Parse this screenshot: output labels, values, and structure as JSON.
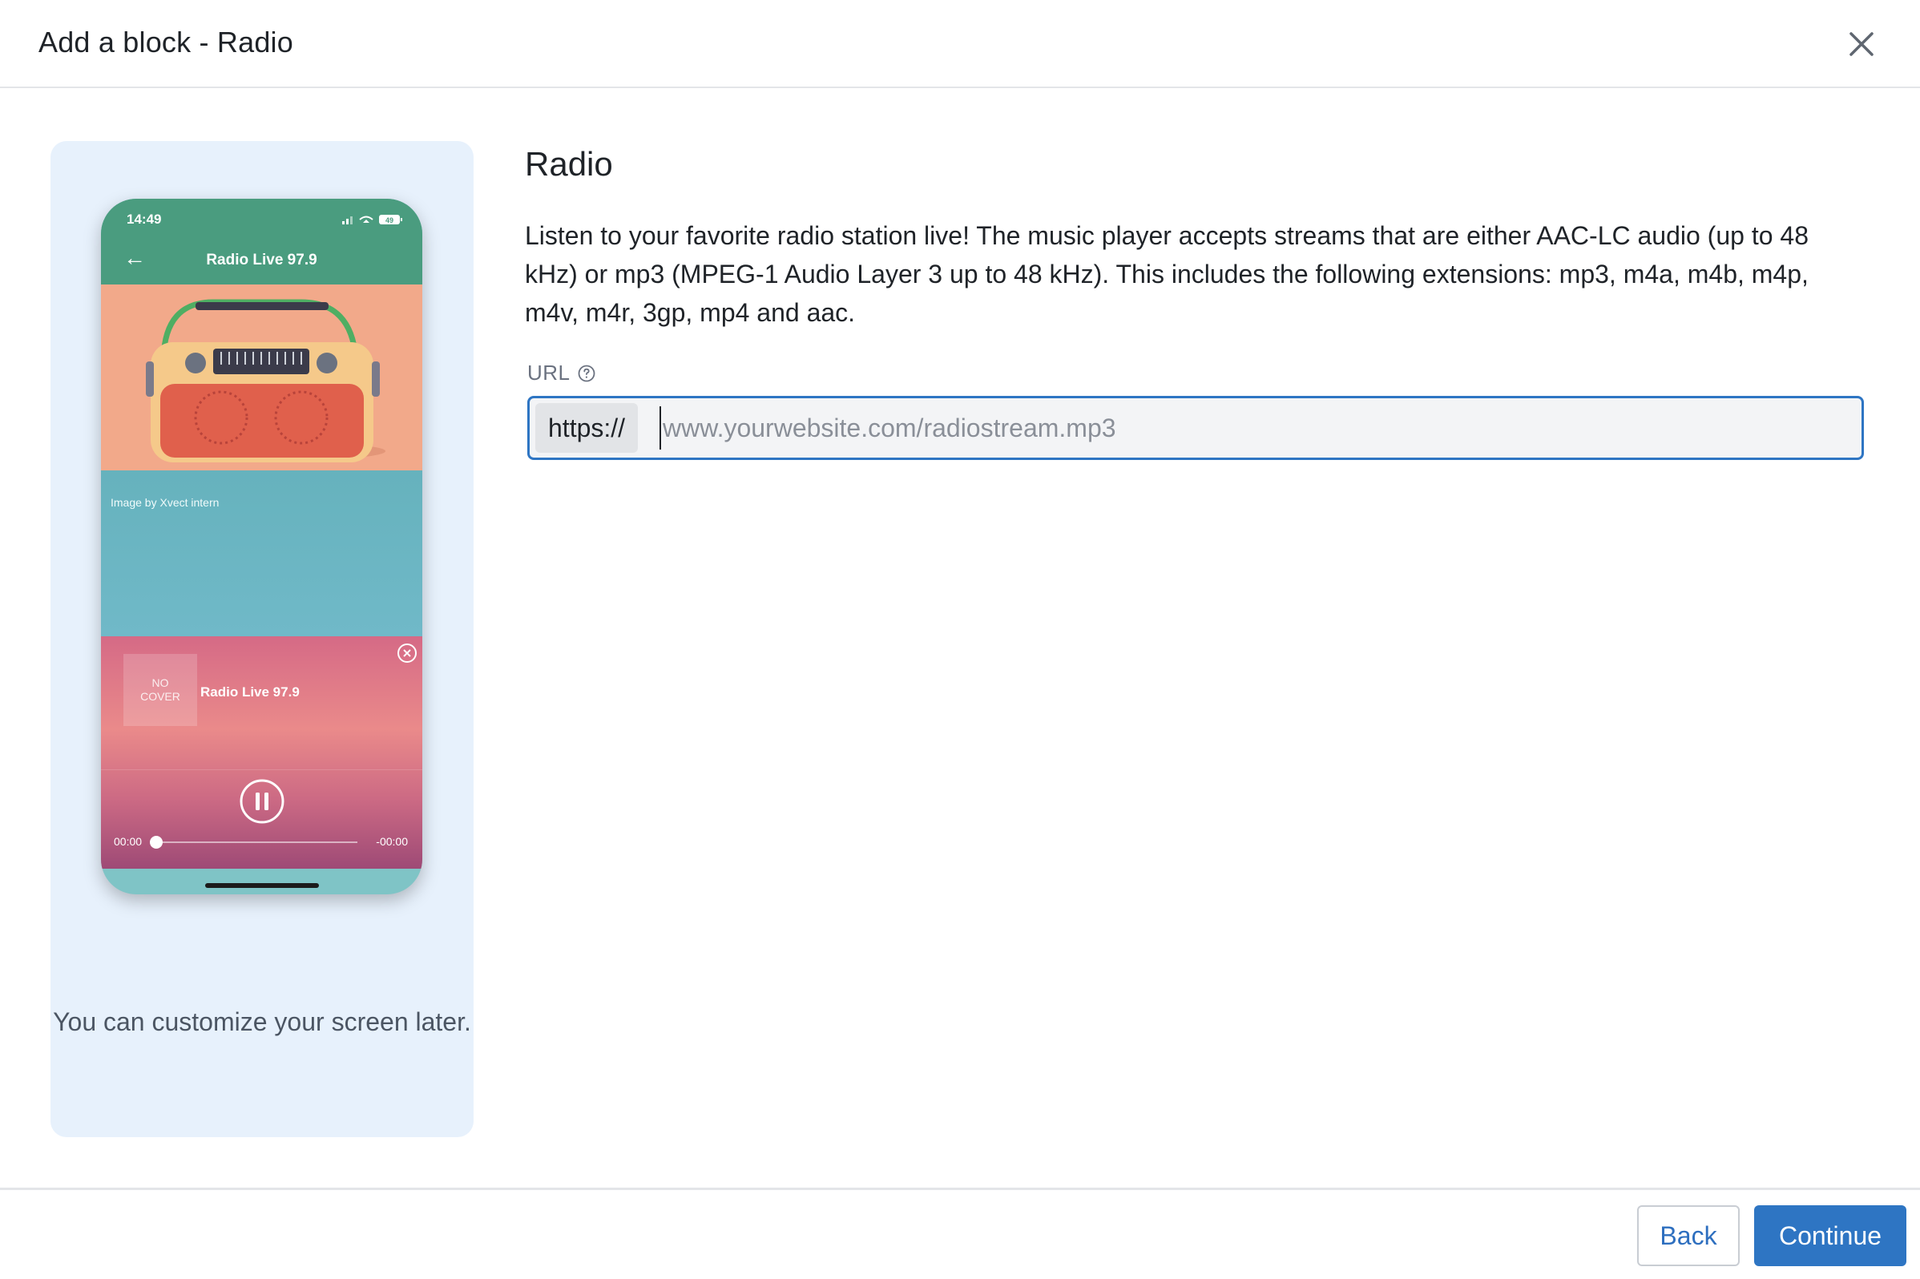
{
  "header": {
    "title": "Add a block - Radio",
    "close_icon": "close-icon"
  },
  "preview": {
    "phone": {
      "status_time": "14:49",
      "battery": "49",
      "screen_title": "Radio Live 97.9",
      "image_credit": "Image by Xvect intern",
      "player": {
        "cover_line1": "NO",
        "cover_line2": "COVER",
        "station_name": "Radio Live 97.9",
        "time_start": "00:00",
        "time_end": "-00:00",
        "progress": 0
      }
    },
    "caption": "You can customize your screen later."
  },
  "main": {
    "title": "Radio",
    "description": "Listen to your favorite radio station live! The music player accepts streams that are either AAC-LC audio (up to 48 kHz) or mp3 (MPEG-1 Audio Layer 3 up to 48 kHz). This includes the following extensions: mp3, m4a, m4b, m4p, m4v, m4r, 3gp, mp4 and aac.",
    "url_label": "URL",
    "url_prefix": "https://",
    "url_value": "",
    "url_placeholder": "www.yourwebsite.com/radiostream.mp3"
  },
  "footer": {
    "back_label": "Back",
    "continue_label": "Continue"
  },
  "colors": {
    "accent": "#2e75c3",
    "panel_bg": "#e7f1fc",
    "phone_header": "#4a9c7f"
  }
}
